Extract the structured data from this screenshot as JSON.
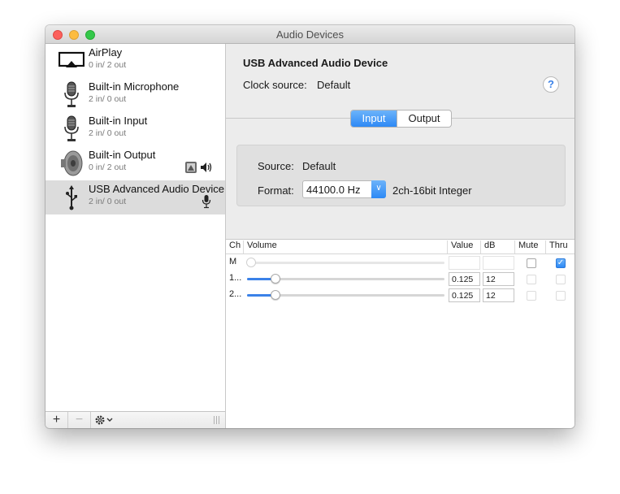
{
  "window": {
    "title": "Audio Devices"
  },
  "devices": [
    {
      "name": "AirPlay",
      "io": "0 in/ 2 out",
      "icon": "airplay-icon"
    },
    {
      "name": "Built-in Microphone",
      "io": "2 in/ 0 out",
      "icon": "microphone-icon"
    },
    {
      "name": "Built-in Input",
      "io": "2 in/ 0 out",
      "icon": "microphone-icon"
    },
    {
      "name": "Built-in Output",
      "io": "0 in/ 2 out",
      "icon": "speaker-icon"
    },
    {
      "name": "USB Advanced Audio Device",
      "io": "2 in/ 0 out",
      "icon": "usb-icon"
    }
  ],
  "footer": {
    "add": "+",
    "remove": "−"
  },
  "detail": {
    "device_title": "USB Advanced Audio Device",
    "clock_label": "Clock source:",
    "clock_value": "Default",
    "help": "?",
    "tabs": [
      "Input",
      "Output"
    ],
    "selected_tab": "Input",
    "source_label": "Source:",
    "source_value": "Default",
    "format_label": "Format:",
    "format_value": "44100.0 Hz",
    "format_desc": "2ch-16bit Integer"
  },
  "table": {
    "headers": [
      "Ch",
      "Volume",
      "Value",
      "dB",
      "Mute",
      "Thru"
    ],
    "rows": [
      {
        "ch": "M",
        "volume": 0,
        "value": "",
        "db": "",
        "mute": false,
        "thru": true,
        "enabled": false
      },
      {
        "ch": "1...",
        "volume": 0.125,
        "value": "0.125",
        "db": "12",
        "mute": false,
        "thru": false,
        "enabled": true
      },
      {
        "ch": "2...",
        "volume": 0.125,
        "value": "0.125",
        "db": "12",
        "mute": false,
        "thru": false,
        "enabled": true
      }
    ]
  },
  "colors": {
    "accent": "#3b82e8",
    "selected_row": "#dcdcdc"
  }
}
